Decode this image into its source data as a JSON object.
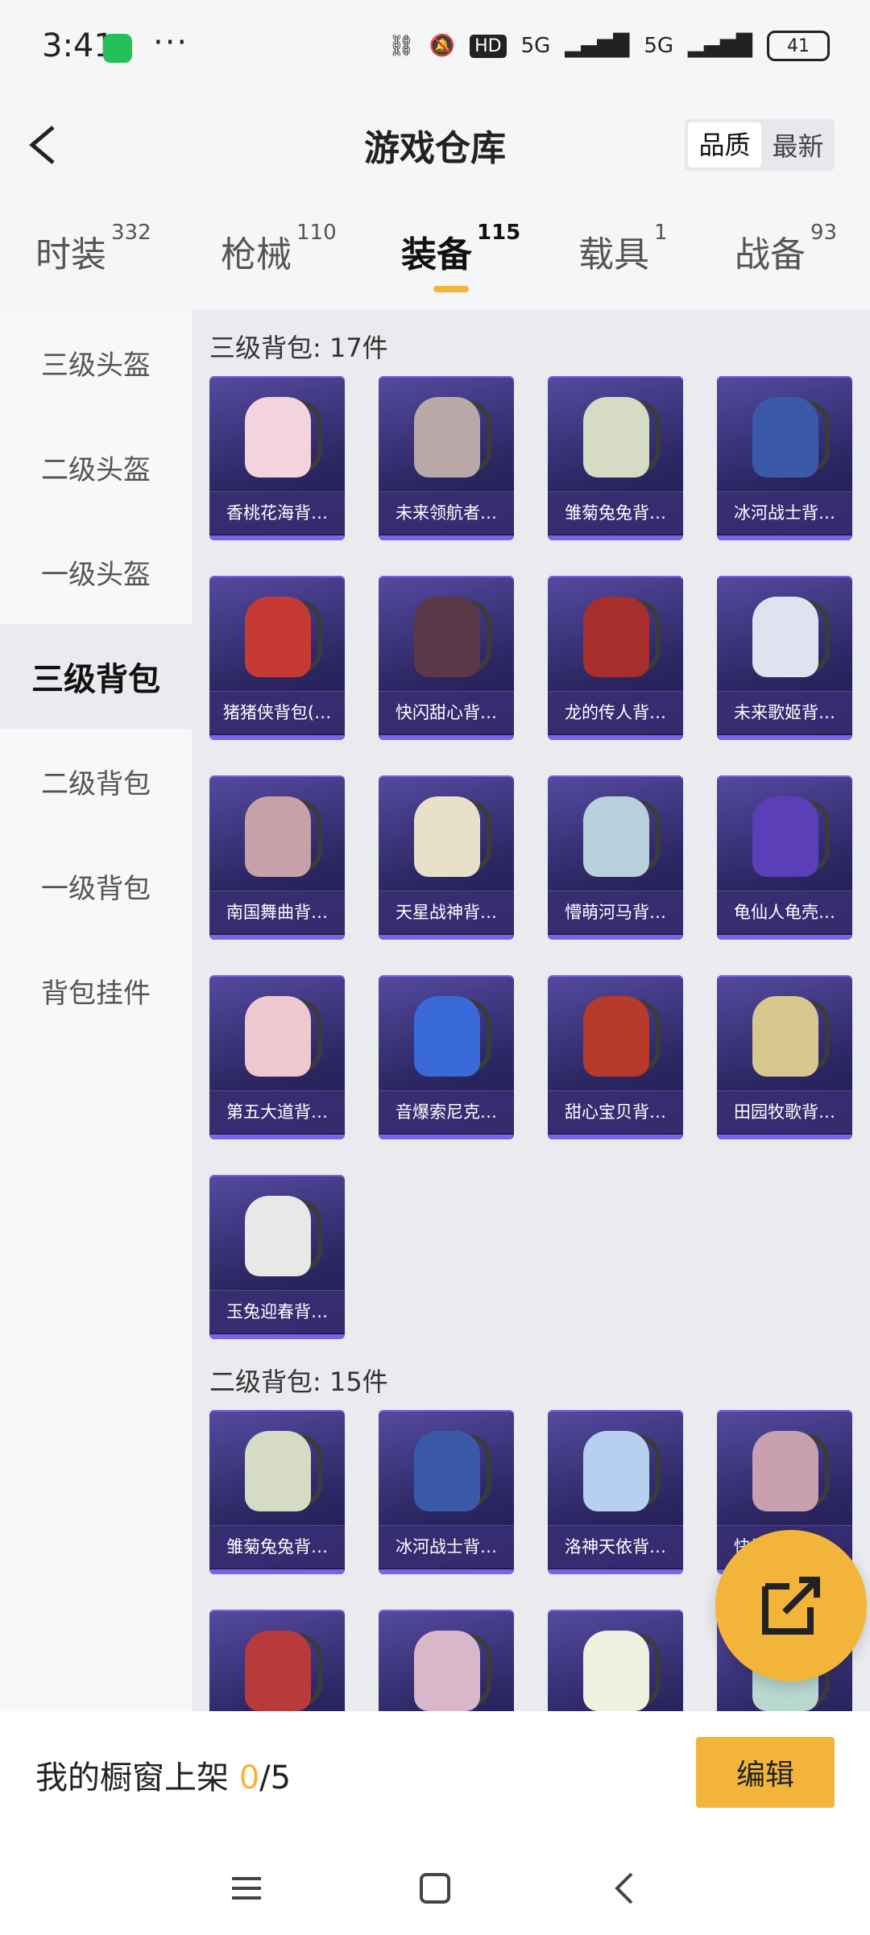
{
  "status": {
    "time": "3:41",
    "dots": "···",
    "hd": "HD",
    "battery": "41",
    "signal1": "5G",
    "signal2": "5G"
  },
  "nav": {
    "title": "游戏仓库",
    "sort_quality": "品质",
    "sort_latest": "最新"
  },
  "tabs": [
    {
      "label": "时装",
      "count": "332"
    },
    {
      "label": "枪械",
      "count": "110"
    },
    {
      "label": "装备",
      "count": "115"
    },
    {
      "label": "载具",
      "count": "1"
    },
    {
      "label": "战备",
      "count": "93"
    }
  ],
  "sidebar": [
    "三级头盔",
    "二级头盔",
    "一级头盔",
    "三级背包",
    "二级背包",
    "一级背包",
    "背包挂件"
  ],
  "sections": [
    {
      "title": "三级背包: 17件",
      "items": [
        "香桃花海背…",
        "未来领航者…",
        "雏菊兔兔背…",
        "冰河战士背…",
        "猪猪侠背包(…",
        "快闪甜心背…",
        "龙的传人背…",
        "未来歌姬背…",
        "南国舞曲背…",
        "天星战神背…",
        "懵萌河马背…",
        "龟仙人龟壳…",
        "第五大道背…",
        "音爆索尼克…",
        "甜心宝贝背…",
        "田园牧歌背…",
        "玉兔迎春背…"
      ]
    },
    {
      "title": "二级背包: 15件",
      "items": [
        "雏菊兔兔背…",
        "冰河战士背…",
        "洛神天依背…",
        "快闪甜心背…",
        "",
        "",
        "",
        ""
      ]
    }
  ],
  "bottom": {
    "showcase_label": "我的橱窗上架",
    "current": "0",
    "total": "/5",
    "edit": "编辑"
  },
  "colors": {
    "accent": "#f2b53a",
    "card_bg": "#2b2561",
    "card_label": "#3c3278"
  }
}
